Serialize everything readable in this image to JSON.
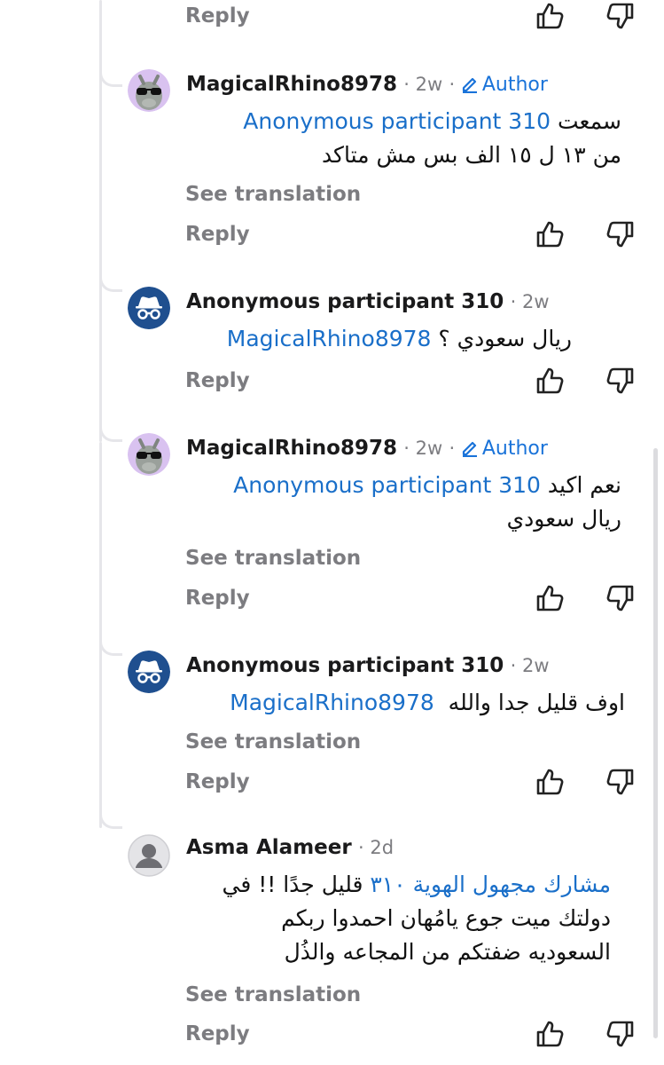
{
  "reply_label": "Reply",
  "see_translation_label": "See translation",
  "author_badge_label": "Author",
  "top_partial": {
    "reply_label": "Reply"
  },
  "comments": [
    {
      "author": "MagicalRhino8978",
      "time": "2w",
      "mention": "Anonymous participant 310",
      "line1": "سمعت",
      "line2": "من ١٣ ل ١٥ الف بس مش متاكد"
    },
    {
      "author": "Anonymous participant 310",
      "time": "2w",
      "mention": "MagicalRhino8978",
      "line1": "ريال سعودي ؟"
    },
    {
      "author": "MagicalRhino8978",
      "time": "2w",
      "mention": "Anonymous participant 310",
      "line1": "نعم اكيد",
      "line2": "ريال سعودي"
    },
    {
      "author": "Anonymous participant 310",
      "time": "2w",
      "mention": "MagicalRhino8978",
      "line1": "اوف قليل جدا والله"
    },
    {
      "author": "Asma Alameer",
      "time": "2d",
      "mention": "مشارك مجهول الهوية ٣١٠",
      "line1": "قليل جدًا !! في",
      "line2": "دولتك ميت جوع يامُهان احمدوا ربكم",
      "line3": "السعوديه ضفتكم من المجاعه والذُل"
    }
  ]
}
